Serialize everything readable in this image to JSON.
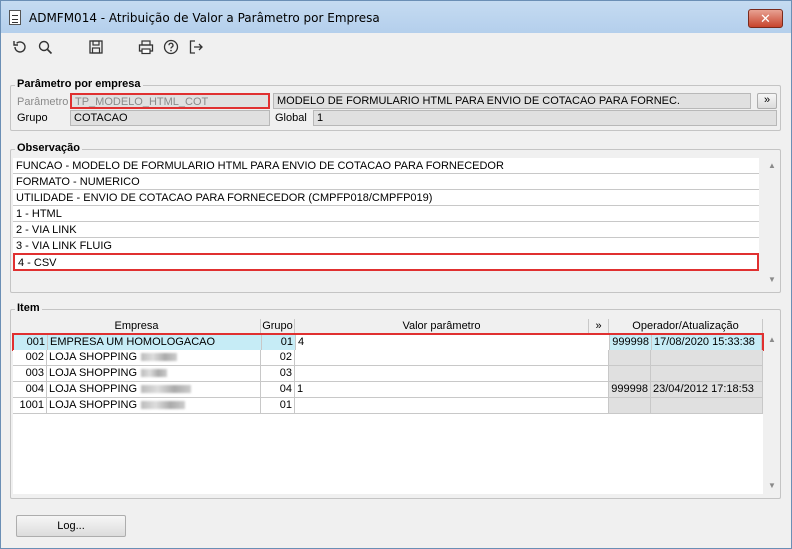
{
  "window": {
    "title": "ADMFM014 - Atribuição de Valor a Parâmetro por Empresa",
    "close_label": "✕"
  },
  "toolbar": {
    "icons": [
      "refresh-icon",
      "search-icon",
      "save-icon",
      "print-icon",
      "help-icon",
      "exit-icon"
    ]
  },
  "param_group": {
    "legend": "Parâmetro por empresa",
    "parametro_label": "Parâmetro",
    "parametro_value": "TP_MODELO_HTML_COT",
    "descricao_value": "MODELO DE FORMULARIO HTML PARA ENVIO DE COTACAO PARA FORNEC.",
    "expand_label": "»",
    "grupo_label": "Grupo",
    "grupo_value": "COTACAO",
    "global_label": "Global",
    "global_value": "1"
  },
  "observacao": {
    "legend": "Observação",
    "lines": [
      "FUNCAO - MODELO DE FORMULARIO HTML PARA ENVIO DE COTACAO PARA FORNECEDOR",
      "FORMATO - NUMERICO",
      "UTILIDADE - ENVIO DE COTACAO PARA FORNECEDOR (CMPFP018/CMPFP019)",
      "1 - HTML",
      "2 - VIA LINK",
      "3 - VIA LINK FLUIG",
      "4 - CSV"
    ]
  },
  "item": {
    "legend": "Item",
    "headers": {
      "empresa": "Empresa",
      "grupo": "Grupo",
      "valor": "Valor parâmetro",
      "expand": "»",
      "operador": "Operador/Atualização"
    },
    "rows": [
      {
        "code": "001",
        "name": "EMPRESA UM  HOMOLOGACAO",
        "grupo": "01",
        "valor": "4",
        "operador": "999998",
        "data": "17/08/2020 15:33:38"
      },
      {
        "code": "002",
        "name": "LOJA SHOPPING",
        "grupo": "02",
        "valor": "",
        "operador": "",
        "data": ""
      },
      {
        "code": "003",
        "name": "LOJA SHOPPING",
        "grupo": "03",
        "valor": "",
        "operador": "",
        "data": ""
      },
      {
        "code": "004",
        "name": "LOJA SHOPPING",
        "grupo": "04",
        "valor": "1",
        "operador": "999998",
        "data": "23/04/2012 17:18:53"
      },
      {
        "code": "1001",
        "name": "LOJA SHOPPING",
        "grupo": "01",
        "valor": "",
        "operador": "",
        "data": ""
      }
    ]
  },
  "footer": {
    "log_label": "Log..."
  }
}
